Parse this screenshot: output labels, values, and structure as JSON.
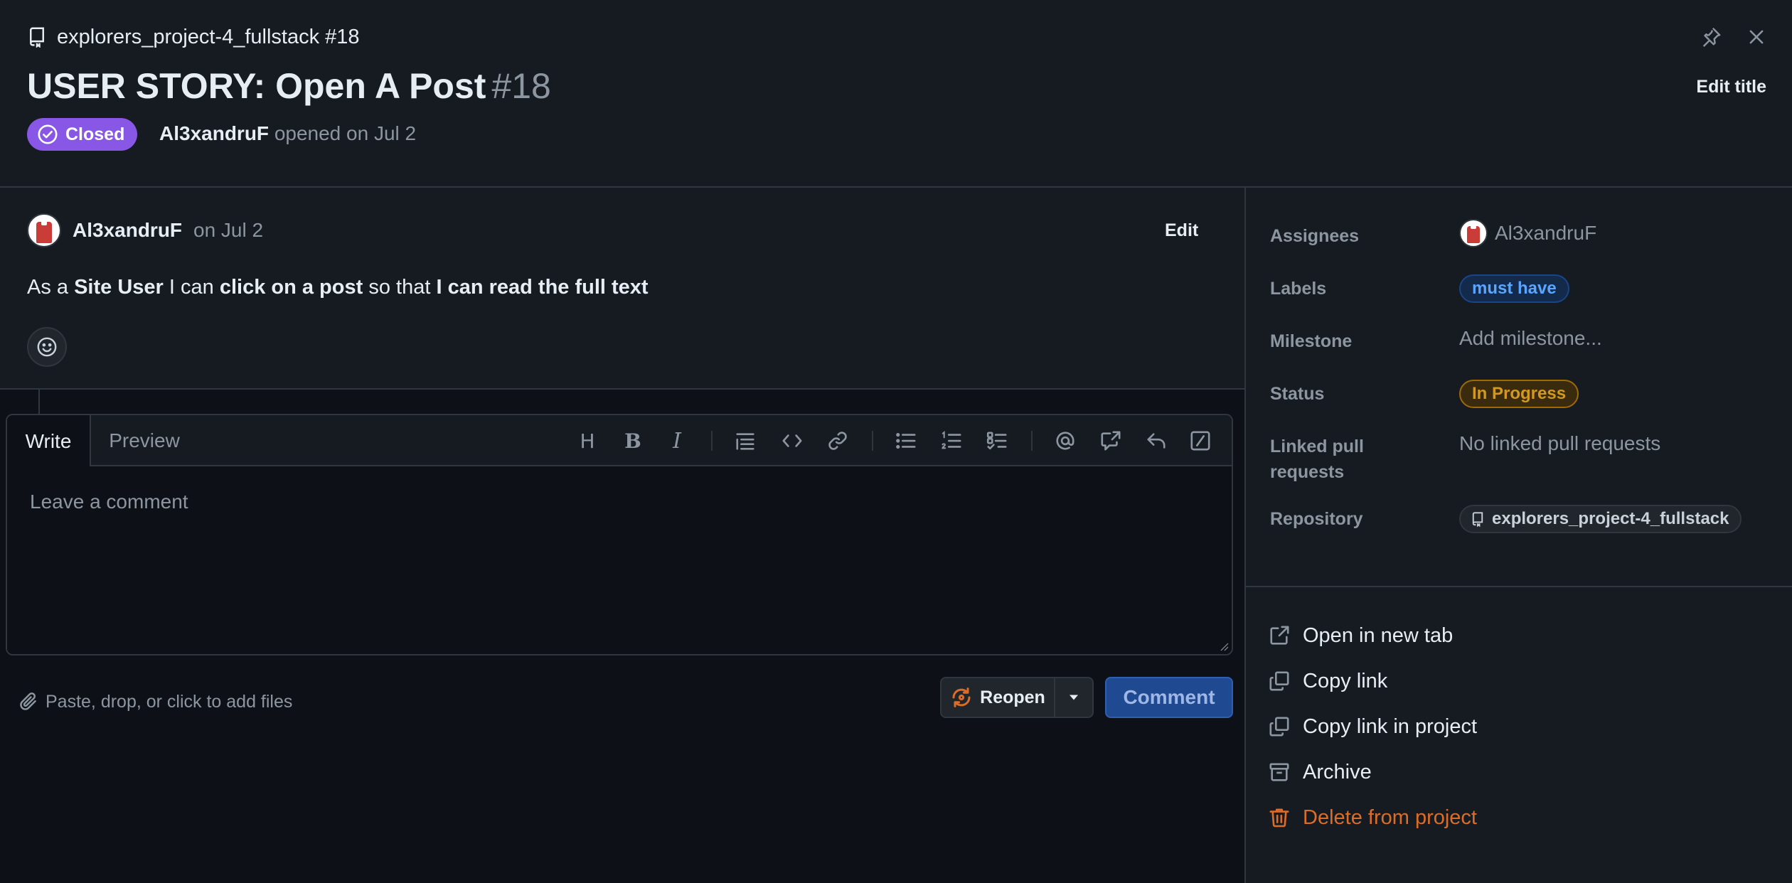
{
  "header": {
    "repo_ref": "explorers_project-4_fullstack #18",
    "title": "USER STORY: Open A Post",
    "number": "#18",
    "state": "Closed",
    "author": "Al3xandruF",
    "opened_text": "opened on Jul 2",
    "edit_title_label": "Edit title"
  },
  "comment": {
    "author": "Al3xandruF",
    "date": "on Jul 2",
    "edit_label": "Edit",
    "body": {
      "p1": "As a ",
      "b1": "Site User",
      "p2": " I can ",
      "b2": "click on a post",
      "p3": " so that ",
      "b3": "I can read the full text"
    }
  },
  "editor": {
    "tab_write": "Write",
    "tab_preview": "Preview",
    "placeholder": "Leave a comment",
    "attach_text": "Paste, drop, or click to add files",
    "reopen_label": "Reopen",
    "comment_label": "Comment"
  },
  "sidebar": {
    "assignees_label": "Assignees",
    "assignee": "Al3xandruF",
    "labels_label": "Labels",
    "label_value": "must have",
    "milestone_label": "Milestone",
    "milestone_value": "Add milestone...",
    "status_label": "Status",
    "status_value": "In Progress",
    "linked_label": "Linked pull requests",
    "linked_value": "No linked pull requests",
    "repository_label": "Repository",
    "repository_value": "explorers_project-4_fullstack",
    "actions": [
      "Open in new tab",
      "Copy link",
      "Copy link in project",
      "Archive",
      "Delete from project"
    ]
  },
  "colors": {
    "closed_badge": "#8957e5",
    "label_blue": "#58a6ff",
    "status_orange": "#d29922",
    "danger": "#db6d28",
    "comment_button": "#1f4a91"
  }
}
